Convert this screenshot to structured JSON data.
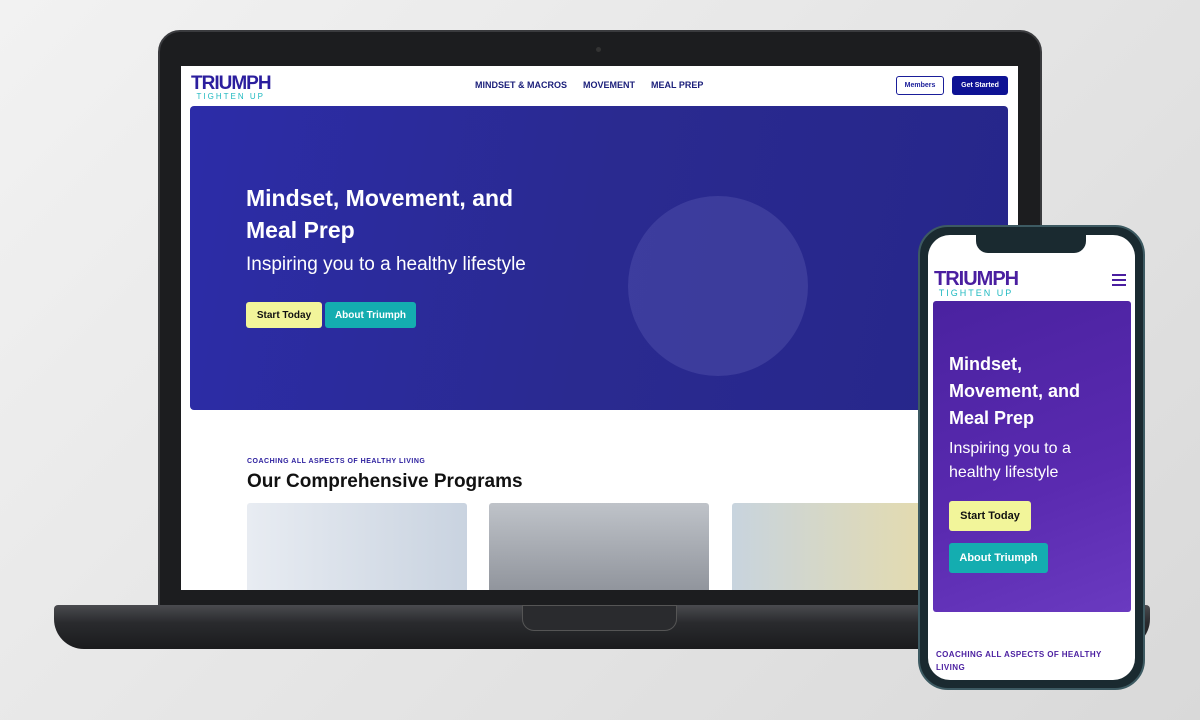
{
  "desktop": {
    "logo": {
      "main": "TRIUMPH",
      "sub": "TIGHTEN UP"
    },
    "nav": [
      "MINDSET & MACROS",
      "MOVEMENT",
      "MEAL PREP"
    ],
    "members": "Members",
    "get_started": "Get Started",
    "hero": {
      "title": "Mindset, Movement, and Meal Prep",
      "subtitle": "Inspiring you to a healthy lifestyle",
      "start": "Start Today",
      "about": "About Triumph"
    },
    "programs": {
      "eyebrow": "COACHING ALL ASPECTS OF HEALTHY LIVING",
      "title": "Our Comprehensive Programs"
    }
  },
  "mobile": {
    "logo": {
      "main": "TRIUMPH",
      "sub": "TIGHTEN UP"
    },
    "hero": {
      "title": "Mindset, Movement, and Meal Prep",
      "subtitle": "Inspiring you to a healthy lifestyle",
      "start": "Start Today",
      "about": "About Triumph"
    },
    "eyebrow": "COACHING ALL ASPECTS OF HEALTHY LIVING"
  },
  "colors": {
    "brand": "#2b1e9e",
    "teal": "#14adb0",
    "yellow": "#f2f59a",
    "purple": "#4a1ea0"
  }
}
